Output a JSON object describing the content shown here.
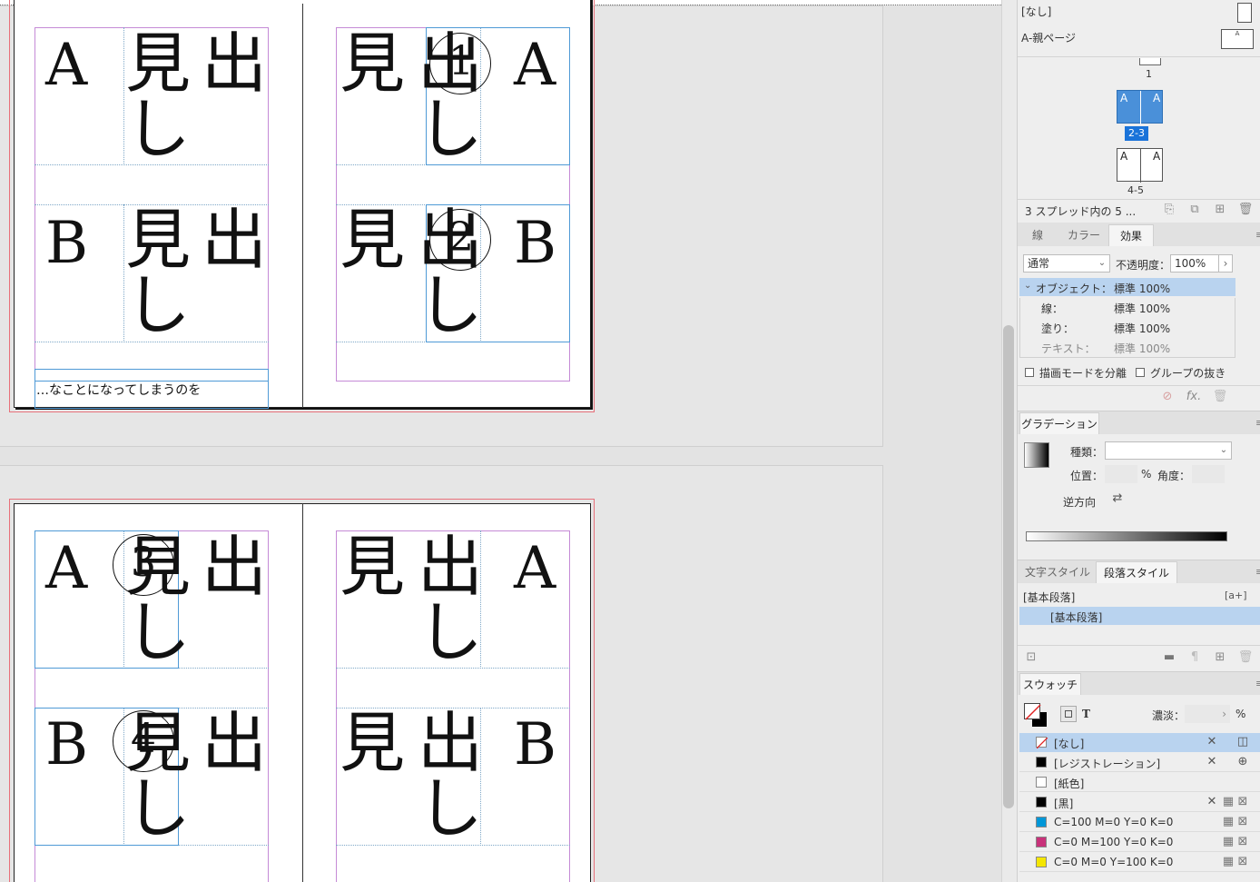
{
  "canvas": {
    "spread1": {
      "left_page": {
        "rows": [
          {
            "letter": "A",
            "heading_chars": [
              "見",
              "出",
              "し"
            ]
          },
          {
            "letter": "B",
            "heading_chars": [
              "見",
              "出",
              "し"
            ]
          }
        ],
        "body_text": "…なことになってしまうのを"
      },
      "right_page": {
        "rows": [
          {
            "letter": "A",
            "heading_chars": [
              "見",
              "出",
              "し"
            ],
            "circled_number": "1"
          },
          {
            "letter": "B",
            "heading_chars": [
              "見",
              "出",
              "し"
            ],
            "circled_number": "2"
          }
        ]
      }
    },
    "spread2": {
      "left_page": {
        "rows": [
          {
            "letter": "A",
            "heading_chars": [
              "見",
              "出",
              "し"
            ],
            "circled_number": "3"
          },
          {
            "letter": "B",
            "heading_chars": [
              "見",
              "出",
              "し"
            ],
            "circled_number": "4"
          }
        ]
      },
      "right_page": {
        "rows": [
          {
            "letter": "A",
            "heading_chars": [
              "見",
              "出",
              "し"
            ]
          },
          {
            "letter": "B",
            "heading_chars": [
              "見",
              "出",
              "し"
            ]
          }
        ]
      }
    }
  },
  "pages_panel": {
    "none_label": "[なし]",
    "master_label": "A-親ページ",
    "page_1": "1",
    "spread_2_3": "2-3",
    "spread_4_5": "4-5",
    "thumb_letter": "A",
    "status": "3 スプレッド内の 5 ..."
  },
  "effects_panel": {
    "tabs": [
      "線",
      "カラー",
      "効果"
    ],
    "blend_mode": "通常",
    "opacity_label": "不透明度：",
    "opacity_value": "100%",
    "rows": [
      {
        "label": "オブジェクト：",
        "value": "標準 100%"
      },
      {
        "label": "線：",
        "value": "標準 100%"
      },
      {
        "label": "塗り：",
        "value": "標準 100%"
      },
      {
        "label": "テキスト：",
        "value": "標準 100%"
      }
    ],
    "isolate_blending": "描画モードを分離",
    "knockout_group": "グループの抜き"
  },
  "gradient_panel": {
    "tab": "グラデーション",
    "type_label": "種類：",
    "location_label": "位置：",
    "percent": "%",
    "angle_label": "角度：",
    "reverse_label": "逆方向"
  },
  "styles_panel": {
    "tabs": [
      "文字スタイル",
      "段落スタイル"
    ],
    "current": "[基本段落]",
    "new_style_icon": "[a+]",
    "items": [
      "[基本段落]"
    ]
  },
  "swatches_panel": {
    "tab": "スウォッチ",
    "text_mode": "T",
    "tint_label": "濃淡：",
    "percent": "%",
    "swatches": [
      {
        "name": "[なし]",
        "color": "none"
      },
      {
        "name": "[レジストレーション]",
        "color": "#000000"
      },
      {
        "name": "[紙色]",
        "color": "#ffffff"
      },
      {
        "name": "[黒]",
        "color": "#000000"
      },
      {
        "name": "C=100 M=0 Y=0 K=0",
        "color": "#0097d8"
      },
      {
        "name": "C=0 M=100 Y=0 K=0",
        "color": "#c8327a"
      },
      {
        "name": "C=0 M=0 Y=100 K=0",
        "color": "#f4e600"
      }
    ]
  }
}
